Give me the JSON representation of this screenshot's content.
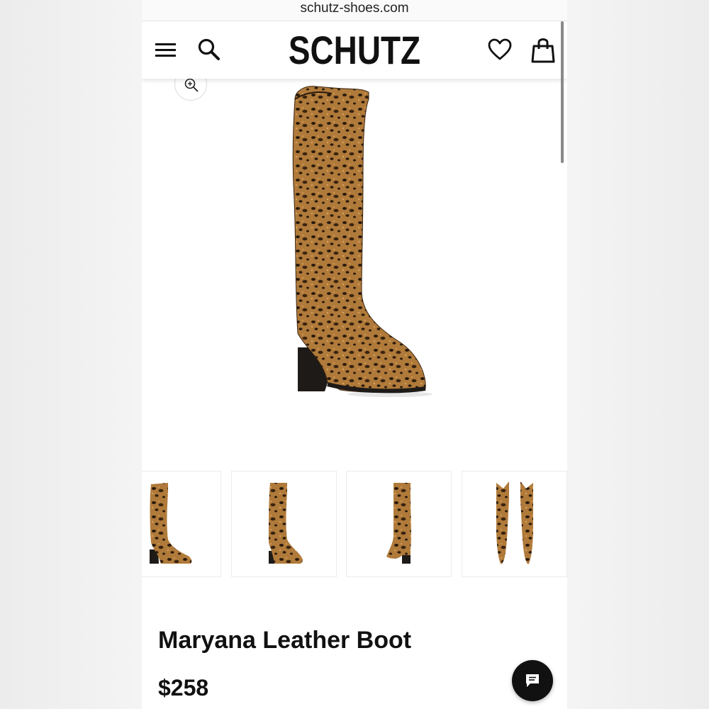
{
  "browser": {
    "url": "schutz-shoes.com"
  },
  "header": {
    "logo": "SCHUTZ",
    "icons": [
      "menu-icon",
      "search-icon",
      "heart-icon",
      "bag-icon"
    ]
  },
  "gallery": {
    "zoom_icon": "zoom-in-icon",
    "thumbnail_count": 4
  },
  "product": {
    "name": "Maryana Leather Boot",
    "price": "$258"
  },
  "chat": {
    "icon": "chat-icon"
  },
  "colors": {
    "brand": "#111111",
    "leopard_base": "#b07a3a",
    "leopard_spot": "#2a1a0c"
  }
}
